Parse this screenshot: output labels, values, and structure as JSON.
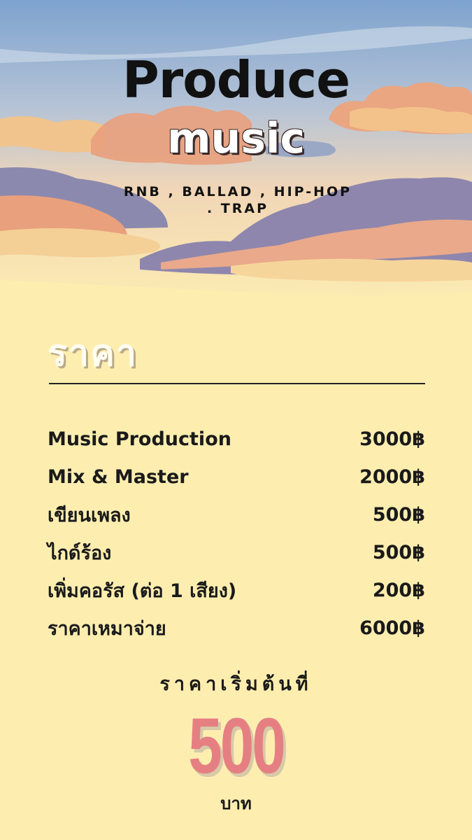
{
  "header": {
    "title": "Produce",
    "subtitle": "music",
    "genres": "RNB , BALLAD , HIP-HOP . TRAP"
  },
  "pricing": {
    "title": "ราคา",
    "items": [
      {
        "name": "Music Production",
        "price": "3000฿"
      },
      {
        "name": "Mix & Master",
        "price": "2000฿"
      },
      {
        "name": "เขียนเพลง",
        "price": "500฿"
      },
      {
        "name": "ไกด์ร้อง",
        "price": "500฿"
      },
      {
        "name": "เพิ่มคอรัส (ต่อ 1 เสียง)",
        "price": "200฿"
      },
      {
        "name": "ราคาเหมาจ่าย",
        "price": "6000฿"
      }
    ]
  },
  "starting": {
    "label": "ราคาเริ่มต้นที่",
    "amount": "500",
    "currency": "บาท"
  },
  "colors": {
    "background": "#fdeeb0",
    "accent_price": "#e57f82",
    "sky_top": "#7fa6d1",
    "cloud_peach": "#e8a07a",
    "cloud_purple": "#8a82a8"
  }
}
